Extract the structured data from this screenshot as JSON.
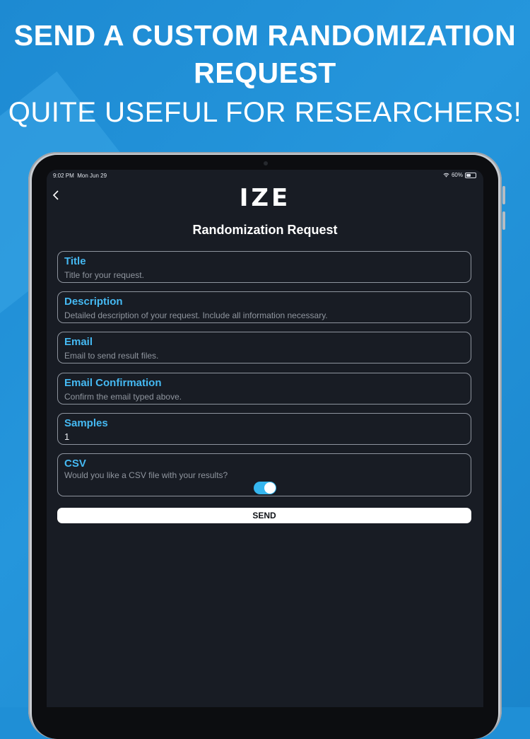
{
  "promo": {
    "headline": "SEND A CUSTOM RANDOMIZATION REQUEST",
    "subline": "QUITE USEFUL FOR RESEARCHERS!"
  },
  "status_bar": {
    "time": "9:02 PM",
    "date": "Mon Jun 29",
    "battery": "60%",
    "battery_level": 0.6
  },
  "app": {
    "logo": "IZE",
    "page_title": "Randomization Request"
  },
  "form": {
    "title": {
      "label": "Title",
      "placeholder": "Title for your request."
    },
    "description": {
      "label": "Description",
      "placeholder": "Detailed description of your request. Include all information necessary."
    },
    "email": {
      "label": "Email",
      "placeholder": "Email to send result files."
    },
    "email_confirmation": {
      "label": "Email Confirmation",
      "placeholder": "Confirm the email typed above."
    },
    "samples": {
      "label": "Samples",
      "value": "1"
    },
    "csv": {
      "label": "CSV",
      "hint": "Would you like a CSV file with your results?",
      "enabled": true
    },
    "send_label": "SEND"
  },
  "colors": {
    "background_blue": "#1f8fd6",
    "screen": "#181c24",
    "label_accent": "#45b9f2",
    "toggle_on": "#35b6ef"
  }
}
